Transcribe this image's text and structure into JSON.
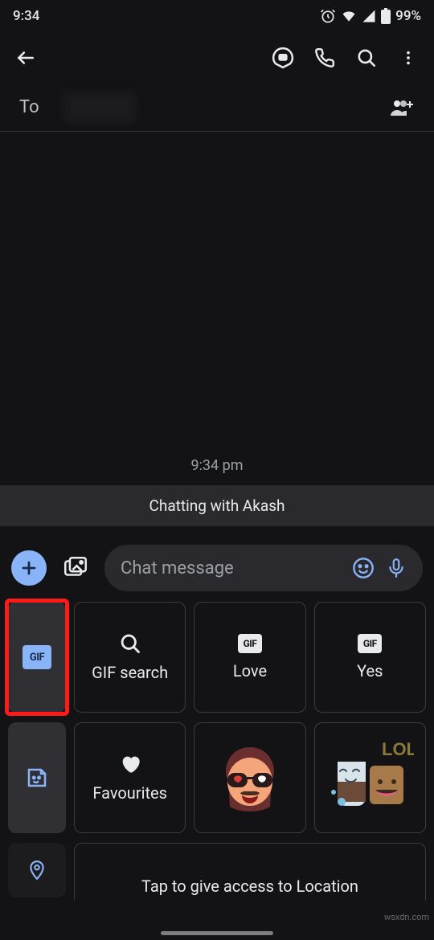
{
  "status": {
    "time": "9:34",
    "battery": "99%"
  },
  "to": {
    "label": "To"
  },
  "conversation": {
    "timestamp": "9:34 pm",
    "banner": "Chatting with Akash"
  },
  "compose": {
    "placeholder": "Chat message"
  },
  "keyboard": {
    "row1": {
      "tab_icon": "gif-icon",
      "cards": [
        {
          "icon": "search-icon",
          "label": "GIF search"
        },
        {
          "icon": "gif-badge",
          "label": "Love"
        },
        {
          "icon": "gif-badge",
          "label": "Yes"
        }
      ]
    },
    "row2": {
      "tab_icon": "sticker-icon",
      "cards": [
        {
          "icon": "heart-icon",
          "label": "Favourites"
        },
        {
          "sticker": "face-sunglasses"
        },
        {
          "sticker": "lol-cups"
        }
      ]
    },
    "row3": {
      "tab_icon": "location-icon",
      "card_label": "Tap to give access to Location"
    }
  },
  "watermark": "wsxdn.com"
}
